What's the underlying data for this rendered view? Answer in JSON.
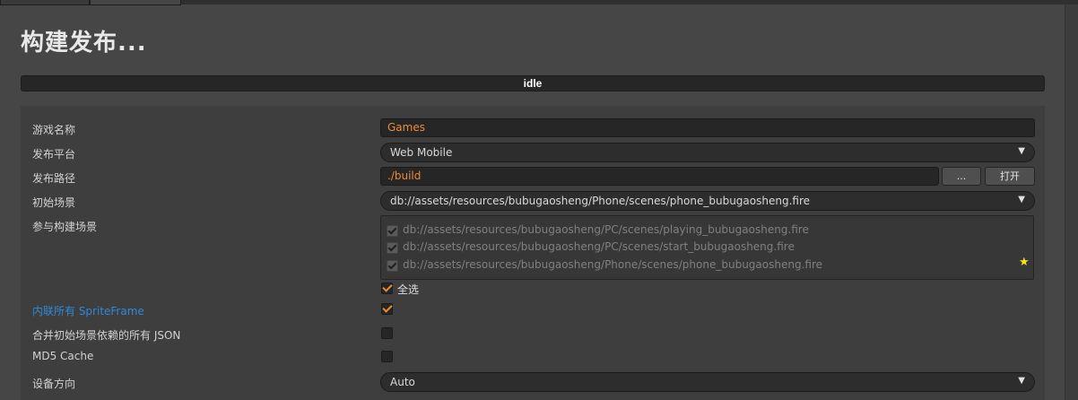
{
  "tabs": [
    {
      "label": ""
    },
    {
      "label": ""
    }
  ],
  "page_title": "构建发布...",
  "status": "idle",
  "form": {
    "game_name": {
      "label": "游戏名称",
      "value": "Games"
    },
    "platform": {
      "label": "发布平台",
      "value": "Web Mobile"
    },
    "build_path": {
      "label": "发布路径",
      "value": "./build",
      "browse_label": "...",
      "open_label": "打开"
    },
    "start_scene": {
      "label": "初始场景",
      "value": "db://assets/resources/bubugaosheng/Phone/scenes/phone_bubugaosheng.fire"
    },
    "included_scenes": {
      "label": "参与构建场景",
      "items": [
        "db://assets/resources/bubugaosheng/PC/scenes/playing_bubugaosheng.fire",
        "db://assets/resources/bubugaosheng/PC/scenes/start_bubugaosheng.fire",
        "db://assets/resources/bubugaosheng/Phone/scenes/phone_bubugaosheng.fire"
      ],
      "select_all_label": "全选",
      "select_all_checked": true
    },
    "inline_spriteframes": {
      "label": "内联所有 SpriteFrame",
      "checked": true
    },
    "merge_json": {
      "label": "合并初始场景依赖的所有 JSON",
      "checked": false
    },
    "md5_cache": {
      "label": "MD5 Cache",
      "checked": false
    },
    "orientation": {
      "label": "设备方向",
      "value": "Auto"
    }
  },
  "colors": {
    "accent": "#f08a2a",
    "link": "#2f8ad8",
    "star": "#ffe11a"
  },
  "icons": {
    "dropdown": "chevron-down-icon",
    "star": "star-icon",
    "check": "check-icon"
  }
}
